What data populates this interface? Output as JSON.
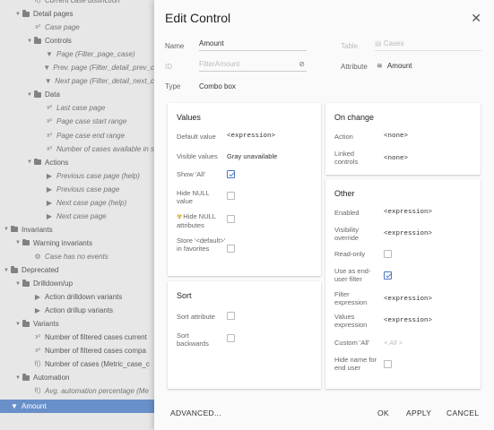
{
  "tree": {
    "rows": [
      {
        "label": "Current case distinction",
        "indent": 2,
        "kind": "leaf",
        "icon": "function-icon",
        "arrow": false
      },
      {
        "label": "Detail pages",
        "indent": 1,
        "kind": "group",
        "icon": "folder-icon",
        "arrow": true
      },
      {
        "label": "Case page",
        "indent": 2,
        "kind": "leaf",
        "icon": "variable-icon",
        "arrow": false
      },
      {
        "label": "Controls",
        "indent": 2,
        "kind": "group",
        "icon": "folder-icon",
        "arrow": true
      },
      {
        "label": "Page (Filter_page_case)",
        "indent": 3,
        "kind": "leaf",
        "icon": "filter-icon",
        "arrow": false
      },
      {
        "label": "Prev. page (Filter_detail_prev_c",
        "indent": 3,
        "kind": "leaf",
        "icon": "filter-icon",
        "arrow": false
      },
      {
        "label": "Next page (Filter_detail_next_c",
        "indent": 3,
        "kind": "leaf",
        "icon": "filter-icon",
        "arrow": false
      },
      {
        "label": "Data",
        "indent": 2,
        "kind": "group",
        "icon": "folder-icon",
        "arrow": true
      },
      {
        "label": "Last case page",
        "indent": 3,
        "kind": "leaf",
        "icon": "variable-icon",
        "arrow": false
      },
      {
        "label": "Page case start range",
        "indent": 3,
        "kind": "leaf",
        "icon": "variable-icon",
        "arrow": false
      },
      {
        "label": "Page case end range",
        "indent": 3,
        "kind": "leaf",
        "icon": "variable-icon",
        "arrow": false
      },
      {
        "label": "Number of cases available in s",
        "indent": 3,
        "kind": "leaf",
        "icon": "variable-icon",
        "arrow": false
      },
      {
        "label": "Actions",
        "indent": 2,
        "kind": "group",
        "icon": "folder-icon",
        "arrow": true
      },
      {
        "label": "Previous case page (help)",
        "indent": 3,
        "kind": "leaf",
        "icon": "action-icon",
        "arrow": false
      },
      {
        "label": "Previous case page",
        "indent": 3,
        "kind": "leaf",
        "icon": "action-icon",
        "arrow": false
      },
      {
        "label": "Next case page (help)",
        "indent": 3,
        "kind": "leaf",
        "icon": "action-icon",
        "arrow": false
      },
      {
        "label": "Next case page",
        "indent": 3,
        "kind": "leaf",
        "icon": "action-icon",
        "arrow": false
      },
      {
        "label": "Invariants",
        "indent": 0,
        "kind": "group",
        "icon": "folder-icon",
        "arrow": true
      },
      {
        "label": "Warning invariants",
        "indent": 1,
        "kind": "group",
        "icon": "folder-icon",
        "arrow": true
      },
      {
        "label": "Case has no events",
        "indent": 2,
        "kind": "leaf",
        "icon": "invariant-icon",
        "arrow": false
      },
      {
        "label": "Deprecated",
        "indent": 0,
        "kind": "group",
        "icon": "folder-icon",
        "arrow": true
      },
      {
        "label": "Drilldown/up",
        "indent": 1,
        "kind": "group",
        "icon": "folder-icon",
        "arrow": true
      },
      {
        "label": "Action drilldown variants",
        "indent": 2,
        "kind": "plain",
        "icon": "action-icon",
        "arrow": false
      },
      {
        "label": "Action drillup variants",
        "indent": 2,
        "kind": "plain",
        "icon": "action-icon",
        "arrow": false
      },
      {
        "label": "Variants",
        "indent": 1,
        "kind": "group",
        "icon": "folder-icon",
        "arrow": true
      },
      {
        "label": "Number of filtered cases current",
        "indent": 2,
        "kind": "plain",
        "icon": "variable-icon",
        "arrow": false
      },
      {
        "label": "Number of filtered cases compa",
        "indent": 2,
        "kind": "plain",
        "icon": "variable-icon",
        "arrow": false
      },
      {
        "label": "Number of cases (Metric_case_c",
        "indent": 2,
        "kind": "plain",
        "icon": "function-icon",
        "arrow": false
      },
      {
        "label": "Automation",
        "indent": 1,
        "kind": "group",
        "icon": "folder-icon",
        "arrow": true
      },
      {
        "label": "Avg. automation percentage (Me",
        "indent": 2,
        "kind": "leaf",
        "icon": "function-icon",
        "arrow": false
      },
      {
        "label": "Amount",
        "indent": 0,
        "kind": "selected",
        "icon": "filter-icon",
        "arrow": false
      }
    ],
    "icon_glyphs": {
      "folder-icon": "",
      "variable-icon": "x²",
      "filter-icon": "▼",
      "action-icon": "▶",
      "function-icon": "f()",
      "invariant-icon": "⚙"
    }
  },
  "dialog": {
    "title": "Edit Control",
    "close_glyph": "✕",
    "name_label": "Name",
    "name_value": "Amount",
    "table_label": "Table",
    "table_value": "Cases",
    "id_label": "ID",
    "id_placeholder": "FilterAmount",
    "link_glyph": "⊘",
    "attribute_label": "Attribute",
    "attribute_value": "Amount",
    "type_label": "Type",
    "type_value": "Combo box"
  },
  "values_card": {
    "title": "Values",
    "default_value_label": "Default value",
    "default_value": "<expression>",
    "visible_values_label": "Visible values",
    "visible_values": "Gray unavailable",
    "show_all_label": "Show 'All'",
    "show_all_checked": true,
    "hide_null_value_label": "Hide NULL value",
    "hide_null_value_checked": false,
    "hide_null_attributes_label": "Hide NULL attributes",
    "hide_null_attributes_checked": false,
    "store_default_label": "Store '<default>' in favorites",
    "store_default_checked": false
  },
  "sort_card": {
    "title": "Sort",
    "sort_attribute_label": "Sort attribute",
    "sort_attribute_checked": false,
    "sort_backwards_label": "Sort backwards",
    "sort_backwards_checked": false
  },
  "onchange_card": {
    "title": "On change",
    "action_label": "Action",
    "action_value": "<none>",
    "linked_label": "Linked controls",
    "linked_value": "<none>"
  },
  "other_card": {
    "title": "Other",
    "enabled_label": "Enabled",
    "enabled_value": "<expression>",
    "visibility_label": "Visibility override",
    "visibility_value": "<expression>",
    "readonly_label": "Read-only",
    "readonly_checked": false,
    "enduser_filter_label": "Use as end-user filter",
    "enduser_filter_checked": true,
    "filter_expr_label": "Filter expression",
    "filter_expr_value": "<expression>",
    "values_expr_label": "Values expression",
    "values_expr_value": "<expression>",
    "custom_all_label": "Custom 'All'",
    "custom_all_value": "< All >",
    "hide_name_label": "Hide name for end user",
    "hide_name_checked": false
  },
  "footer": {
    "advanced": "ADVANCED...",
    "ok": "OK",
    "apply": "APPLY",
    "cancel": "CANCEL"
  },
  "colors": {
    "accent": "#4a78bf",
    "selection": "#4a78bf",
    "panel_bg": "#e2e2e2",
    "dialog_bg": "#fafafa"
  }
}
